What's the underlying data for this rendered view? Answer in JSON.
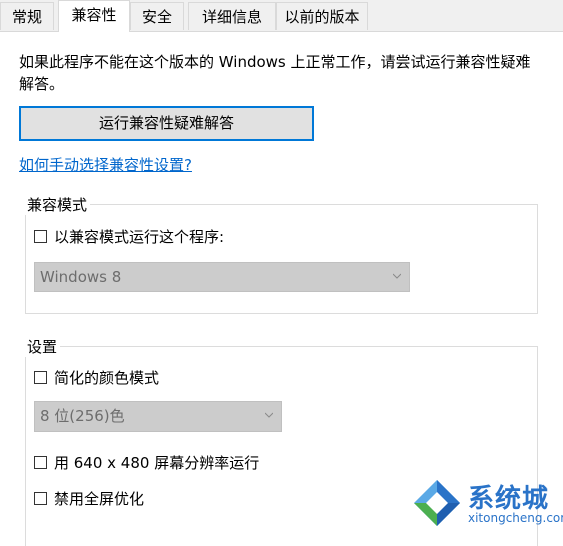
{
  "tabs": [
    {
      "label": "常规"
    },
    {
      "label": "兼容性"
    },
    {
      "label": "安全"
    },
    {
      "label": "详细信息"
    },
    {
      "label": "以前的版本"
    }
  ],
  "active_tab": "兼容性",
  "intro_text": "如果此程序不能在这个版本的 Windows 上正常工作，请尝试运行兼容性疑难解答。",
  "troubleshoot_button": "运行兼容性疑难解答",
  "help_link": "如何手动选择兼容性设置?",
  "compat_mode": {
    "title": "兼容模式",
    "checkbox_label": "以兼容模式运行这个程序:",
    "checked": false,
    "os_select": "Windows 8"
  },
  "settings": {
    "title": "设置",
    "reduced_color": {
      "label": "简化的颜色模式",
      "checked": false
    },
    "color_select": "8 位(256)色",
    "res_640": {
      "label": "用 640 x 480 屏幕分辨率运行",
      "checked": false
    },
    "disable_fullscreen": {
      "label": "禁用全屏优化",
      "checked": false
    }
  },
  "watermark": {
    "brand": "系统城",
    "url": "xitongcheng.com",
    "colors": {
      "blue": "#2a73c8",
      "green": "#4caf50",
      "light_blue": "#5aa9e6"
    }
  }
}
